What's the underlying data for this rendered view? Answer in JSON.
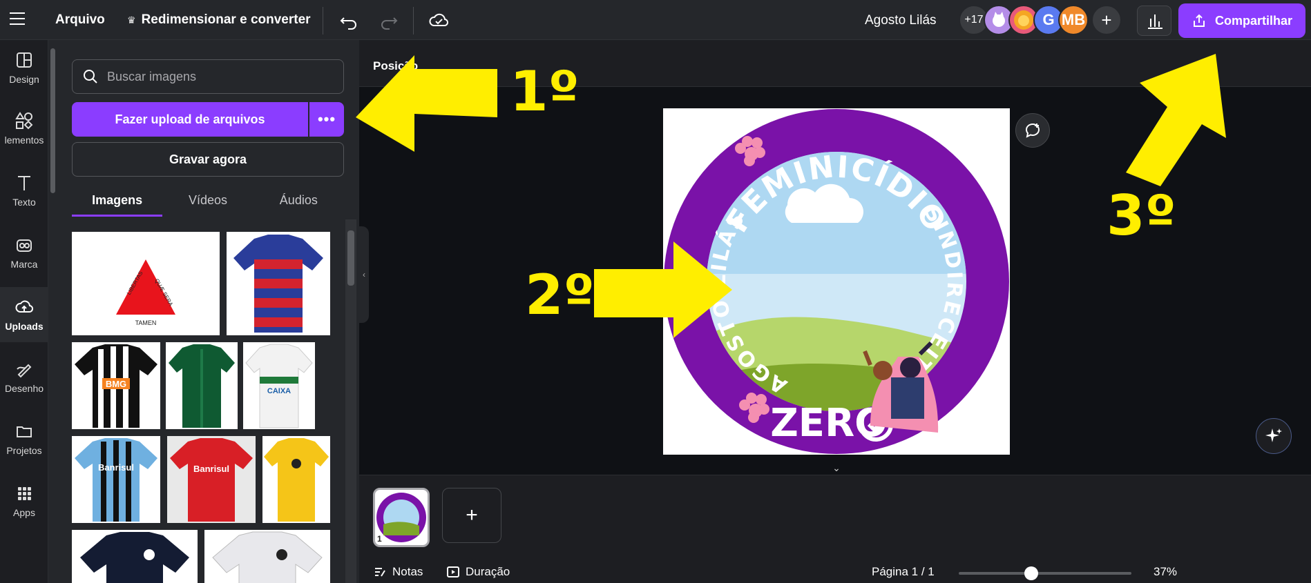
{
  "topbar": {
    "file_label": "Arquivo",
    "resize_label": "Redimensionar e converter",
    "doc_title": "Agosto Lilás",
    "more_collaborators": "+17",
    "avatar_initials": [
      "G",
      "MB"
    ],
    "share_label": "Compartilhar"
  },
  "rail": [
    {
      "label": "Design",
      "icon": "layout-icon"
    },
    {
      "label": "lementos",
      "icon": "shapes-icon"
    },
    {
      "label": "Texto",
      "icon": "text-icon"
    },
    {
      "label": "Marca",
      "icon": "brand-icon"
    },
    {
      "label": "Uploads",
      "icon": "cloud-upload-icon",
      "active": true
    },
    {
      "label": "Desenho",
      "icon": "pen-icon"
    },
    {
      "label": "Projetos",
      "icon": "folder-icon"
    },
    {
      "label": "Apps",
      "icon": "apps-grid-icon"
    }
  ],
  "panel": {
    "search_placeholder": "Buscar imagens",
    "upload_label": "Fazer upload de arquivos",
    "upload_more": "•••",
    "record_label": "Gravar agora",
    "tabs": [
      "Imagens",
      "Vídeos",
      "Áudios"
    ],
    "active_tab": "Imagens",
    "thumb_texts": {
      "flag_words": [
        "LIBERTAS",
        "QUÆ SERA",
        "TAMEN"
      ],
      "bmg": "BMG",
      "caixa": "CAIXA",
      "banrisul": "Banrisul"
    }
  },
  "workspace": {
    "position_label": "Posição",
    "design_text": {
      "ring_top": "FEMINICÍDIO",
      "ring_right": "SINDIRECEITA",
      "ring_left": "AGOSTO LILÁS",
      "badge": "ZERO"
    },
    "page_thumb_num": "1",
    "add_page": "+",
    "footer": {
      "notes": "Notas",
      "duration": "Duração",
      "page_indicator": "Página 1 / 1",
      "zoom": "37%",
      "zoom_fraction": 0.37
    }
  },
  "annotations": [
    "1º",
    "2º",
    "3º"
  ],
  "colors": {
    "accent": "#8b3dff",
    "annotation": "#ffee00",
    "ring": "#7a12a8"
  }
}
